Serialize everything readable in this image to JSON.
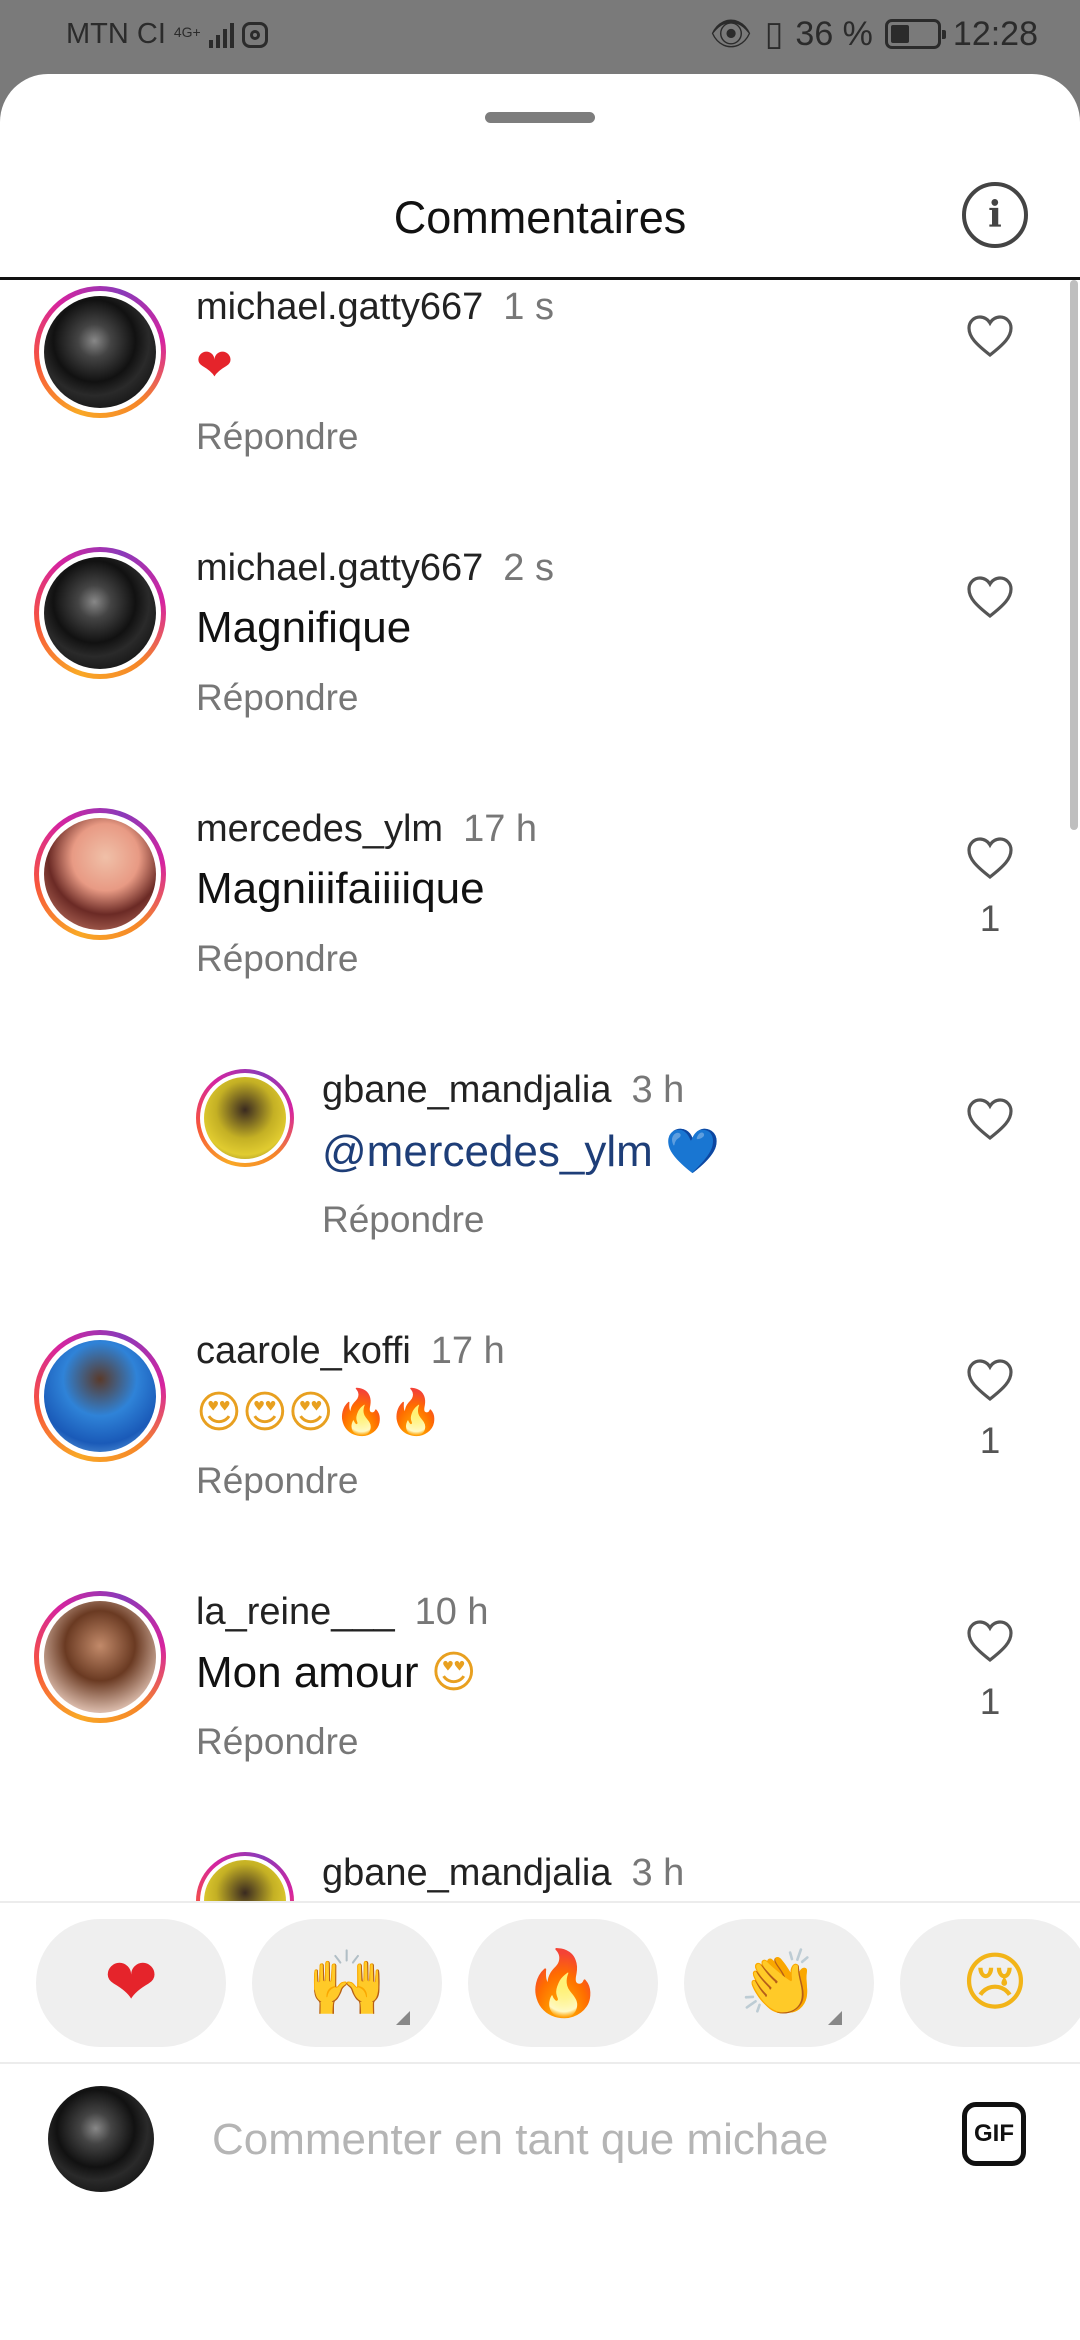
{
  "status_bar": {
    "carrier": "MTN CI",
    "network": "4G+",
    "battery": "36 %",
    "time": "12:28"
  },
  "header": {
    "title": "Commentaires",
    "info_icon": "info-icon"
  },
  "comments": [
    {
      "username": "michael.gatty667",
      "time": "1 s",
      "text": "❤",
      "reply_label": "Répondre",
      "likes": ""
    },
    {
      "username": "michael.gatty667",
      "time": "2 s",
      "text": "Magnifique",
      "reply_label": "Répondre",
      "likes": ""
    },
    {
      "username": "mercedes_ylm",
      "time": "17 h",
      "text": "Magniiifaiiiique",
      "reply_label": "Répondre",
      "likes": "1"
    },
    {
      "username": "gbane_mandjalia",
      "time": "3 h",
      "text_mention": "@mercedes_ylm",
      "text_emoji": "💙",
      "reply_label": "Répondre",
      "likes": ""
    },
    {
      "username": "caarole_koffi",
      "time": "17 h",
      "text": "😍😍😍🔥🔥",
      "reply_label": "Répondre",
      "likes": "1"
    },
    {
      "username": "la_reine___",
      "time": "10 h",
      "text": "Mon amour",
      "text_emoji": "😍",
      "reply_label": "Répondre",
      "likes": "1"
    },
    {
      "username": "gbane_mandjalia",
      "time": "3 h"
    }
  ],
  "reactions": [
    "❤",
    "🙌",
    "🔥",
    "👏",
    "😢"
  ],
  "composer": {
    "placeholder": "Commenter en tant que michae",
    "gif_label": "GIF"
  }
}
